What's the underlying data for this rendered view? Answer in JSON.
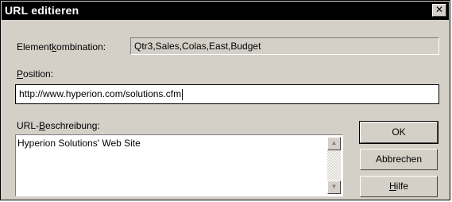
{
  "window": {
    "title": "URL editieren",
    "close_glyph": "✕"
  },
  "fields": {
    "combination_label_pre": "Element",
    "combination_label_key": "k",
    "combination_label_post": "ombination:",
    "combination_value": "Qtr3,Sales,Colas,East,Budget",
    "position_label_key": "P",
    "position_label_post": "osition:",
    "position_value": "http://www.hyperion.com/solutions.cfm",
    "description_label_pre": "URL-",
    "description_label_key": "B",
    "description_label_post": "eschreibung:",
    "description_value": "Hyperion Solutions' Web Site"
  },
  "buttons": {
    "ok": "OK",
    "cancel": "Abbrechen",
    "help_key": "H",
    "help_post": "ilfe"
  },
  "icons": {
    "scroll_up": "▲",
    "scroll_down": "▼"
  }
}
